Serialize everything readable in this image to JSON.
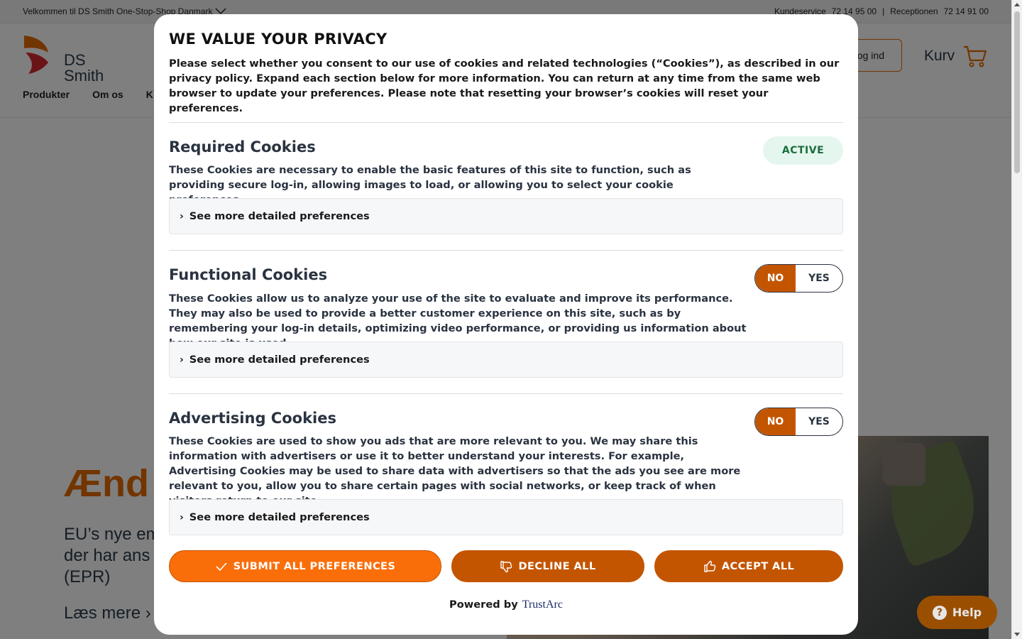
{
  "site": {
    "welcome": "Velkommen til DS Smith One-Stop-Shop Danmark",
    "contact": {
      "kundeservice_label": "Kundeservice",
      "kundeservice_phone": "72 14 95 00",
      "separator": "|",
      "reception_label": "Receptionen",
      "reception_phone": "72 14 91 00"
    },
    "logo_line1": "DS",
    "logo_line2": "Smith",
    "login_label": "Log ind",
    "cart_label": "Kurv",
    "nav": [
      "Produkter",
      "Om os",
      "K"
    ],
    "hero_title": "Ænd",
    "hero_text": "EU’s nye em\nder har ans\n(EPR)",
    "hero_link": "Læs mere  ›"
  },
  "help_button": {
    "label": "Help",
    "icon": "question-icon"
  },
  "modal": {
    "title": "WE VALUE YOUR PRIVACY",
    "intro": "Please select whether you consent to our use of cookies and related technologies (“Cookies”), as described in our privacy policy. Expand each section below for more information. You can return at any time from the same web browser to update your preferences. Please note that resetting your browser’s cookies will reset your preferences.",
    "sections": [
      {
        "title": "Required Cookies",
        "description": "These Cookies are necessary to enable the basic features of this site to function, such as providing secure log-in, allowing images to load, or allowing you to select your cookie preferences.",
        "status": "ACTIVE",
        "details_label": "See more detailed preferences"
      },
      {
        "title": "Functional Cookies",
        "description": "These Cookies allow us to analyze your use of the site to evaluate and improve its performance. They may also be used to provide a better customer experience on this site, such as by remembering your log-in details, optimizing video performance, or providing us information about how our site is used.",
        "toggle": {
          "no": "NO",
          "yes": "YES",
          "selected": "NO"
        },
        "details_label": "See more detailed preferences"
      },
      {
        "title": "Advertising Cookies",
        "description": "These Cookies are used to show you ads that are more relevant to you. We may share this information with advertisers or use it to better understand your interests. For example, Advertising Cookies may be used to share data with advertisers so that the ads you see are more relevant to you, allow you to share certain pages with social networks, or keep track of when visitors return to our site.",
        "toggle": {
          "no": "NO",
          "yes": "YES",
          "selected": "NO"
        },
        "details_label": "See more detailed preferences"
      }
    ],
    "buttons": {
      "submit": "SUBMIT ALL PREFERENCES",
      "decline": "DECLINE ALL",
      "accept": "ACCEPT ALL"
    },
    "powered_by": "Powered by",
    "brand": "TrustArc"
  },
  "colors": {
    "accent": "#c45500",
    "accent_light": "#fa6e0a",
    "active_bg": "#e5f6ee",
    "active_text": "#1a6e3c"
  }
}
